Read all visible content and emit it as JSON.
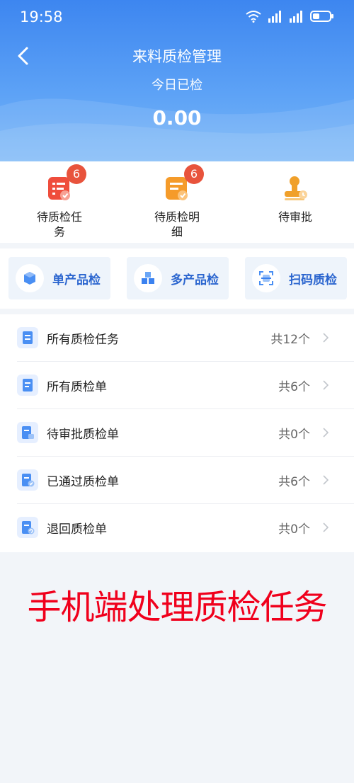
{
  "status": {
    "time": "19:58"
  },
  "header": {
    "title": "来料质检管理",
    "subtitle": "今日已检",
    "value": "0.00"
  },
  "quick": [
    {
      "label": "待质检任\n务",
      "badge": "6",
      "icon": "task-icon",
      "color": "#ef4d3c"
    },
    {
      "label": "待质检明\n细",
      "badge": "6",
      "icon": "detail-icon",
      "color": "#f59b2a"
    },
    {
      "label": "待审批",
      "badge": "",
      "icon": "stamp-icon",
      "color": "#f0a02a"
    }
  ],
  "buttons": [
    {
      "label": "单产品检",
      "icon": "cube-icon"
    },
    {
      "label": "多产品检",
      "icon": "cubes-icon"
    },
    {
      "label": "扫码质检",
      "icon": "scan-icon"
    }
  ],
  "list": [
    {
      "label": "所有质检任务",
      "count": "共12个"
    },
    {
      "label": "所有质检单",
      "count": "共6个"
    },
    {
      "label": "待审批质检单",
      "count": "共0个"
    },
    {
      "label": "已通过质检单",
      "count": "共6个"
    },
    {
      "label": "退回质检单",
      "count": "共0个"
    }
  ],
  "caption": "手机端处理质检任务"
}
